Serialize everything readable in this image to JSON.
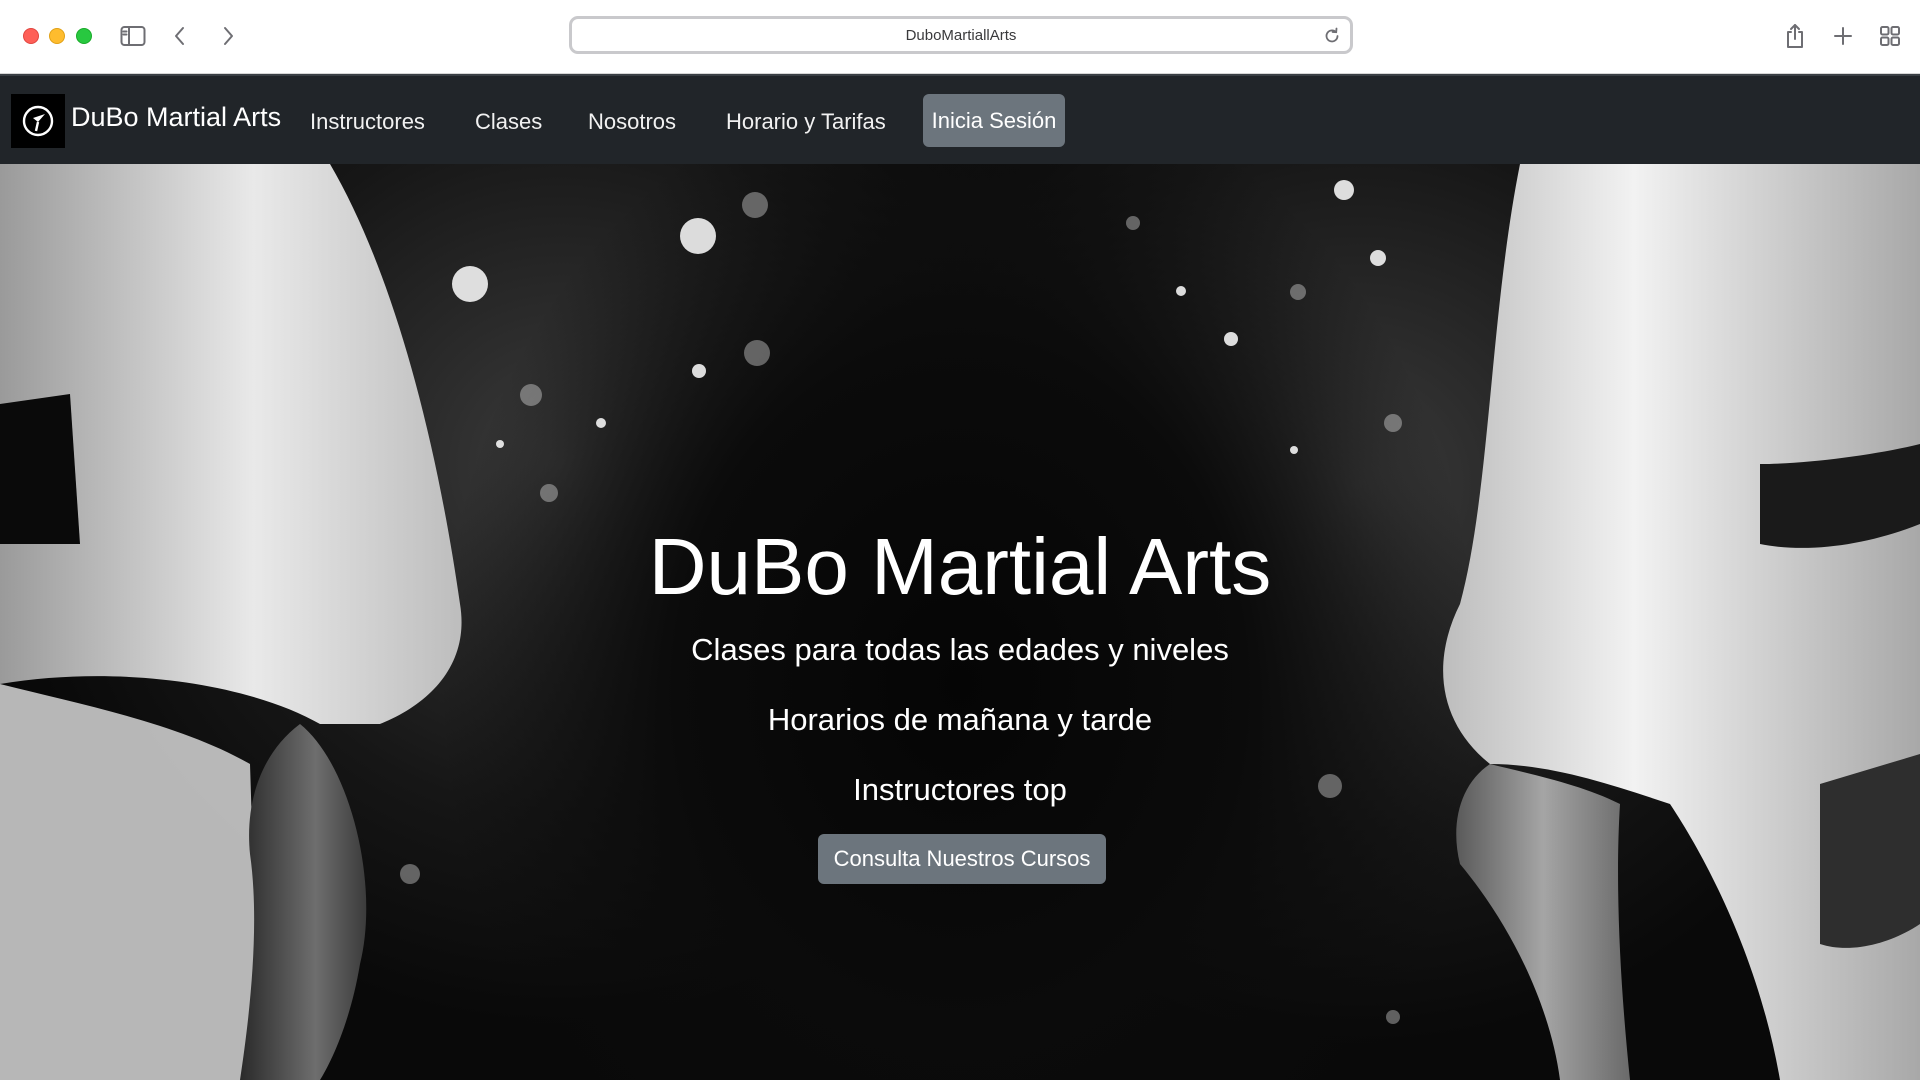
{
  "browser": {
    "url": "DuboMartiallArts",
    "icons": [
      "sidebar-icon",
      "back-icon",
      "forward-icon",
      "reload-icon",
      "share-icon",
      "new-tab-icon",
      "tab-overview-icon"
    ]
  },
  "navbar": {
    "brand": "DuBo Martial Arts",
    "links": [
      {
        "label": "Instructores"
      },
      {
        "label": "Clases"
      },
      {
        "label": "Nosotros"
      },
      {
        "label": "Horario y Tarifas"
      }
    ],
    "login_label": "Inicia Sesión",
    "colors": {
      "background": "#212529",
      "active_button": "#6c757d"
    }
  },
  "hero": {
    "title": "DuBo Martial Arts",
    "lines": [
      "Clases para todas las edades y niveles",
      "Horarios de mañana y tarde",
      "Instructores top"
    ],
    "cta_label": "Consulta Nuestros Cursos",
    "colors": {
      "cta": "#6c757d",
      "text": "#ffffff"
    }
  }
}
